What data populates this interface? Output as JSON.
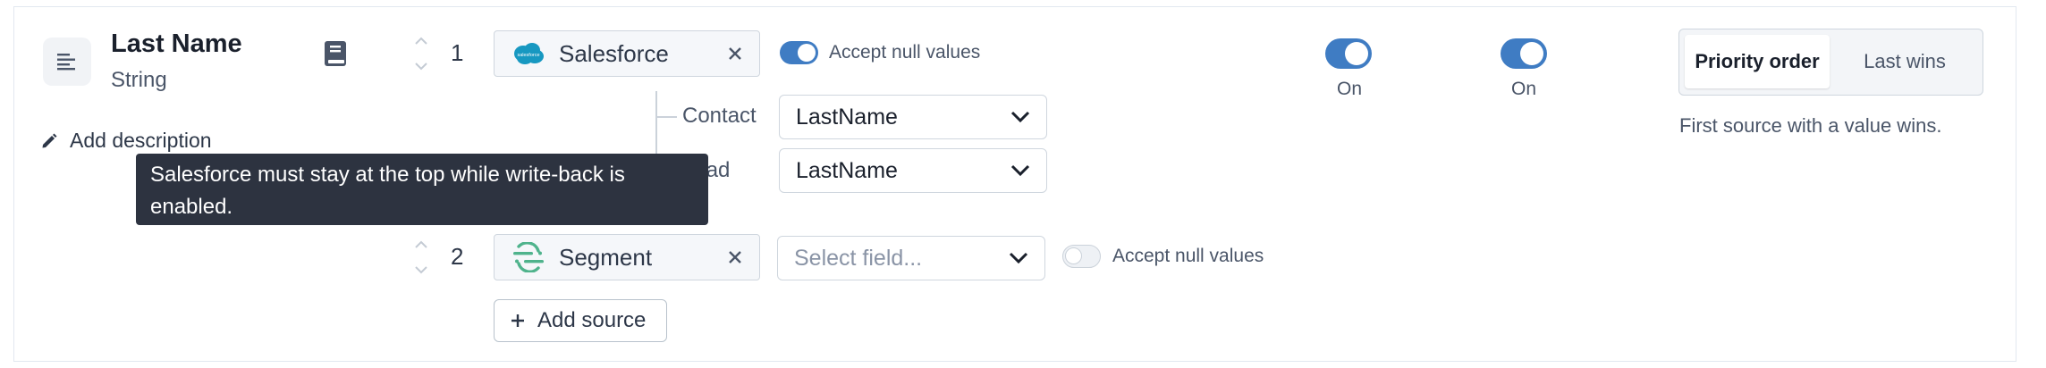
{
  "field": {
    "name": "Last Name",
    "type": "String",
    "add_description_label": "Add description"
  },
  "sources": [
    {
      "order": "1",
      "name": "Salesforce",
      "logo_text": "salesforce",
      "accept_null_label": "Accept null values",
      "accept_null_on": true,
      "mappings": [
        {
          "object": "Contact",
          "field": "LastName"
        },
        {
          "object": "Lead",
          "field": "LastName"
        }
      ]
    },
    {
      "order": "2",
      "name": "Segment",
      "field_placeholder": "Select field...",
      "accept_null_label": "Accept null values",
      "accept_null_on": false
    }
  ],
  "add_source_label": "Add source",
  "tooltip_text": "Salesforce must stay at the top while write-back is enabled.",
  "toggles": [
    {
      "label": "On",
      "on": true
    },
    {
      "label": "On",
      "on": true
    }
  ],
  "strategy": {
    "options": [
      "Priority order",
      "Last wins"
    ],
    "selected": "Priority order",
    "description": "First source with a value wins."
  },
  "colors": {
    "accent": "#3f7cc3",
    "tooltip_bg": "#2d3340",
    "segment_green": "#4fb38c",
    "salesforce_blue": "#1798c1"
  }
}
